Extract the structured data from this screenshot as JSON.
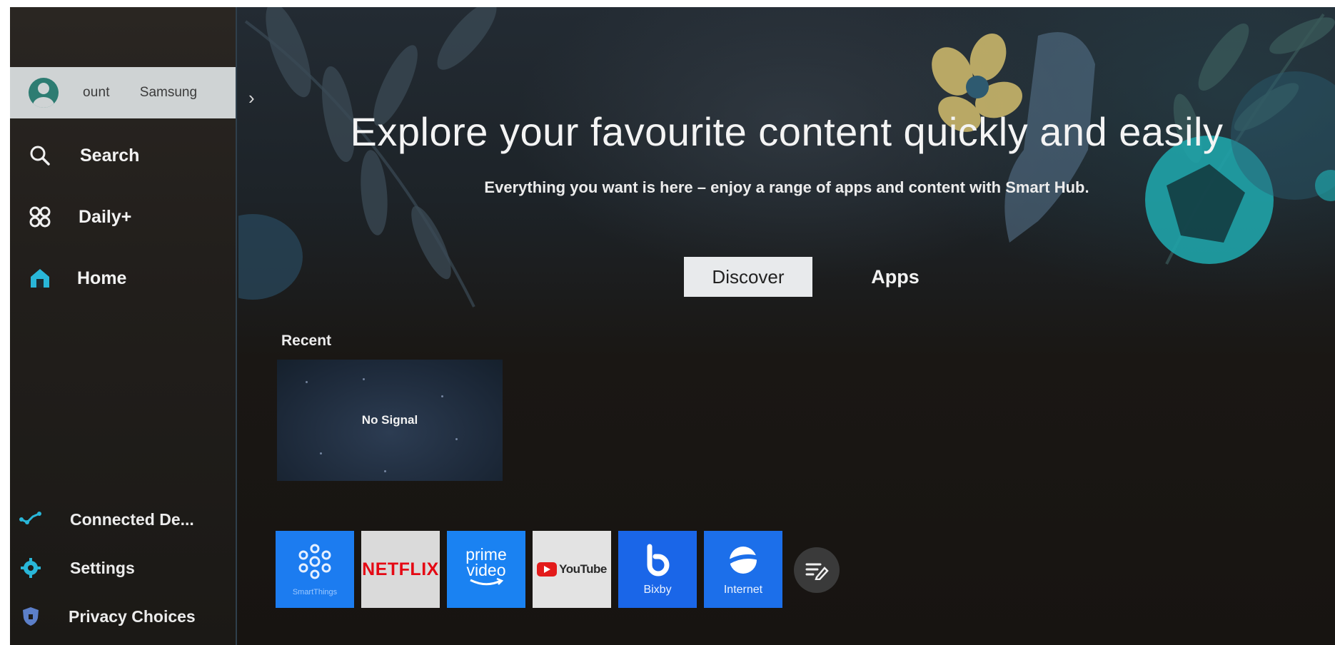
{
  "sidebar": {
    "account": {
      "label": "ount",
      "name": "Samsung"
    },
    "items": [
      {
        "label": "Search",
        "icon": "search-icon"
      },
      {
        "label": "Daily+",
        "icon": "daily-plus-icon"
      },
      {
        "label": "Home",
        "icon": "home-icon"
      }
    ],
    "bottom_items": [
      {
        "label": "Connected De...",
        "icon": "connected-devices-icon"
      },
      {
        "label": "Settings",
        "icon": "gear-icon"
      },
      {
        "label": "Privacy Choices",
        "icon": "shield-icon"
      }
    ]
  },
  "hero": {
    "headline": "Explore your favourite content quickly and easily",
    "subline": "Everything you want is here – enjoy a range of apps and content with Smart Hub."
  },
  "tabs": [
    {
      "label": "Discover",
      "selected": true
    },
    {
      "label": "Apps",
      "selected": false
    }
  ],
  "recent": {
    "label": "Recent",
    "card_text": "No Signal"
  },
  "apps": [
    {
      "name": "SmartThings",
      "label": "SmartThings",
      "icon": "smartthings-icon",
      "color": "#1c7cf0"
    },
    {
      "name": "Netflix",
      "label": "NETFLIX",
      "icon": "netflix-logo",
      "color": "#e50914"
    },
    {
      "name": "Prime Video",
      "label": "prime video",
      "icon": "prime-video-logo",
      "color": "#1a82f2"
    },
    {
      "name": "YouTube",
      "label": "YouTube",
      "icon": "youtube-logo",
      "color": "#e31b1b"
    },
    {
      "name": "Bixby",
      "label": "Bixby",
      "icon": "bixby-icon",
      "color": "#1a66e8"
    },
    {
      "name": "Internet",
      "label": "Internet",
      "icon": "internet-icon",
      "color": "#1c6fea"
    }
  ],
  "edit_button": {
    "icon": "edit-list-icon"
  },
  "colors": {
    "accent": "#1c7cf0",
    "home_icon": "#29b6d8"
  }
}
